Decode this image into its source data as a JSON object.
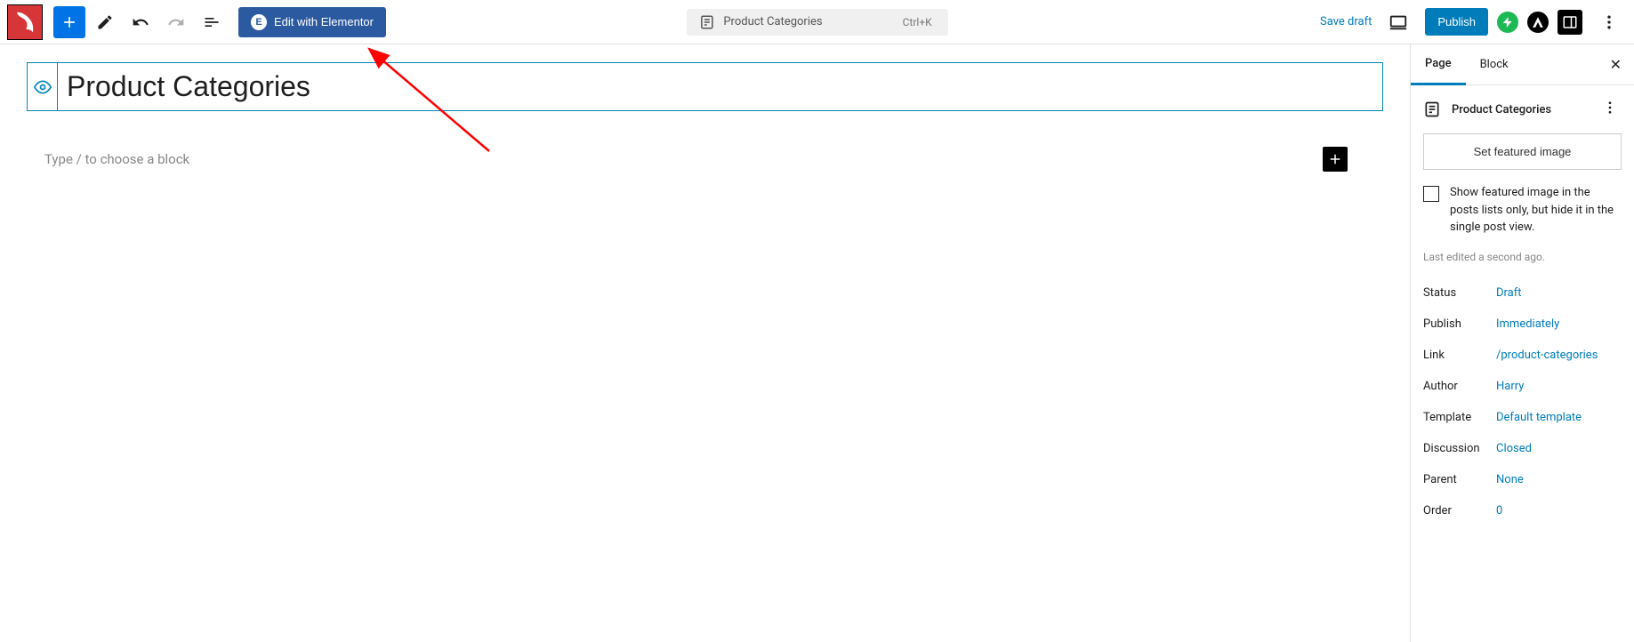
{
  "topbar": {
    "elementor_button": "Edit with Elementor",
    "doc_title": "Product Categories",
    "shortcut": "Ctrl+K",
    "save_draft": "Save draft",
    "publish": "Publish"
  },
  "editor": {
    "title_value": "Product Categories",
    "block_placeholder": "Type / to choose a block"
  },
  "sidebar": {
    "tabs": {
      "page": "Page",
      "block": "Block"
    },
    "page_title": "Product Categories",
    "featured_button": "Set featured image",
    "checkbox_text": "Show featured image in the posts lists only, but hide it in the single post view.",
    "last_edited": "Last edited a second ago.",
    "meta": {
      "status_label": "Status",
      "status_value": "Draft",
      "publish_label": "Publish",
      "publish_value": "Immediately",
      "link_label": "Link",
      "link_value": "/product-categories",
      "author_label": "Author",
      "author_value": "Harry",
      "template_label": "Template",
      "template_value": "Default template",
      "discussion_label": "Discussion",
      "discussion_value": "Closed",
      "parent_label": "Parent",
      "parent_value": "None",
      "order_label": "Order",
      "order_value": "0"
    }
  }
}
